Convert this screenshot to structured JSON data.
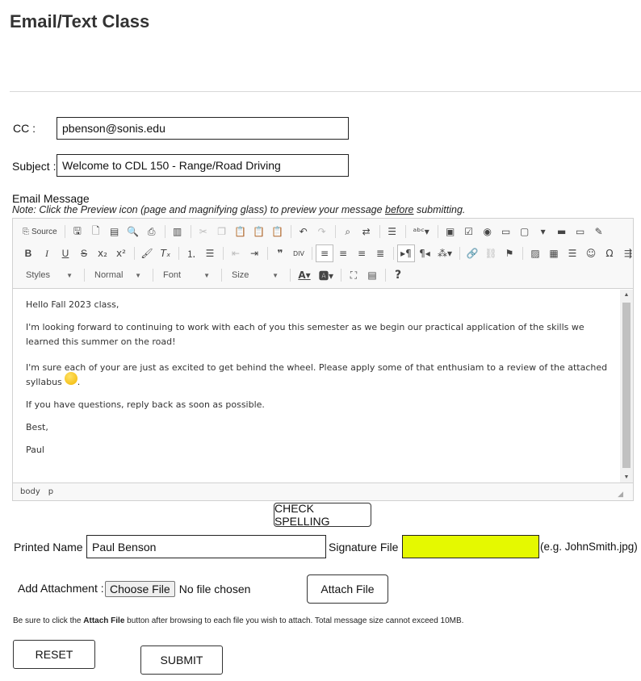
{
  "page_title": "Email/Text Class",
  "cc": {
    "label": "CC :",
    "value": "pbenson@sonis.edu"
  },
  "subject": {
    "label": "Subject :",
    "value": "Welcome to CDL 150 - Range/Road Driving"
  },
  "email_message": {
    "label": "Email Message",
    "note_prefix": "Note: Click the Preview icon (page and magnifying glass) to preview your message ",
    "note_emphasis": "before",
    "note_suffix": " submitting."
  },
  "editor": {
    "toolbar": {
      "source_label": "Source",
      "styles_label": "Styles",
      "format_label": "Normal",
      "font_label": "Font",
      "size_label": "Size"
    },
    "content": {
      "greeting": "Hello Fall 2023 class,",
      "paragraph1": "I'm looking forward to continuing to work with each of you this semester as we begin our practical application of the skills we learned this summer on the road!",
      "paragraph2": "I'm sure each of your are just as excited to get behind the wheel. Please apply some of that enthusiam to a review of the attached syllabus",
      "paragraph2_end": ".",
      "paragraph3": "If you have questions, reply back as soon as possible.",
      "closing": "Best,",
      "signature": "Paul"
    },
    "path": [
      "body",
      "p"
    ]
  },
  "check_spelling_label": "CHECK SPELLING",
  "printed_name": {
    "label": "Printed Name",
    "value": "Paul Benson"
  },
  "signature_file": {
    "label": "Signature File",
    "value": "",
    "hint": "(e.g. JohnSmith.jpg)",
    "highlight_color": "#e5f900"
  },
  "attachment": {
    "label": "Add Attachment :",
    "choose_label": "Choose File",
    "no_file_text": "No file chosen",
    "attach_label": "Attach File"
  },
  "instructions": {
    "prefix": "Be sure to click the ",
    "bold": "Attach File",
    "suffix": " button after browsing to each file you wish to attach.  Total message size cannot exceed 10MB."
  },
  "reset_label": "RESET",
  "submit_label": "SUBMIT"
}
